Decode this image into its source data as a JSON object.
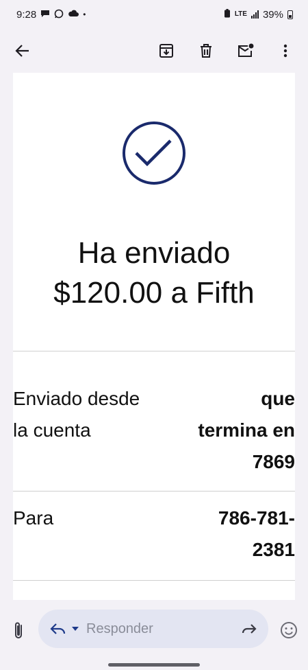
{
  "status_bar": {
    "time": "9:28",
    "network": "LTE",
    "battery": "39%"
  },
  "toolbar": {
    "actions": [
      "archive-icon",
      "delete-icon",
      "mark-unread-icon",
      "more-icon"
    ]
  },
  "message": {
    "headline_line1": "Ha enviado",
    "headline_line2": "$120.00 a Fifth",
    "rows": [
      {
        "label_line1": "Enviado desde",
        "label_line2": "la cuenta",
        "value_line1": "que",
        "value_line2": "termina en",
        "value_line3": "7869"
      },
      {
        "label_line1": "Para",
        "value_line1": "786-781-",
        "value_line2": "2381"
      }
    ]
  },
  "reply": {
    "placeholder": "Responder"
  },
  "colors": {
    "check_blue": "#1a2a6c",
    "background": "#f3f1f6",
    "reply_pill": "#e3e5f2"
  }
}
